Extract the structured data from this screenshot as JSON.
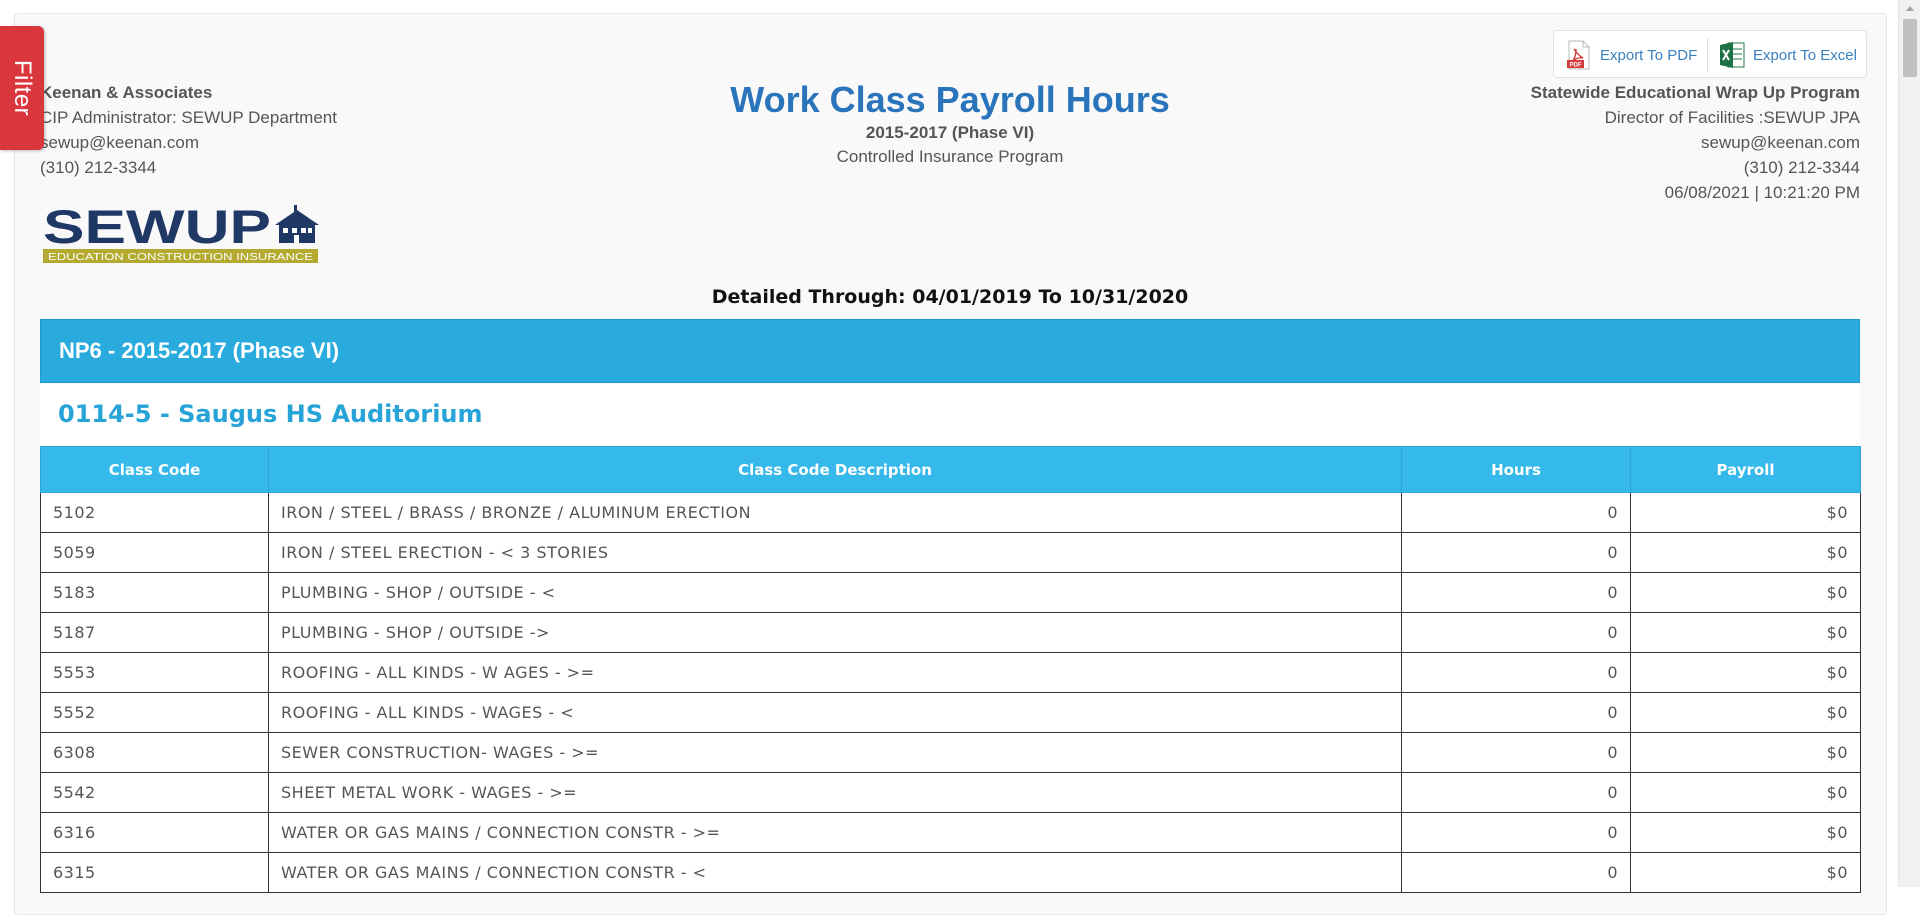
{
  "filter_tab": {
    "label": "Filter"
  },
  "export": {
    "pdf_label": "Export To PDF",
    "excel_label": "Export To Excel"
  },
  "left_info": {
    "company": "Keenan & Associates",
    "administrator": "CIP Administrator: SEWUP Department",
    "email": "sewup@keenan.com",
    "phone": "(310) 212-3344"
  },
  "logo": {
    "text": "SEWUP",
    "tagline": "EDUCATION CONSTRUCTION INSURANCE"
  },
  "header": {
    "title": "Work Class Payroll Hours",
    "subtitle": "2015-2017 (Phase VI)",
    "program": "Controlled Insurance Program"
  },
  "right_info": {
    "program_name": "Statewide Educational Wrap Up Program",
    "director": "Director of Facilities :SEWUP JPA",
    "email": "sewup@keenan.com",
    "phone": "(310) 212-3344",
    "datetime": "06/08/2021 | 10:21:20 PM"
  },
  "detailed_through": "Detailed Through: 04/01/2019 To 10/31/2020",
  "group_title": "NP6 - 2015-2017 (Phase VI)",
  "project_title": "0114-5 - Saugus HS Auditorium",
  "table": {
    "headers": [
      "Class Code",
      "Class Code Description",
      "Hours",
      "Payroll"
    ],
    "rows": [
      [
        "5102",
        "IRON / STEEL / BRASS / BRONZE / ALUMINUM ERECTION",
        "0",
        "$0"
      ],
      [
        "5059",
        "IRON / STEEL ERECTION - < 3 STORIES",
        "0",
        "$0"
      ],
      [
        "5183",
        "PLUMBING - SHOP / OUTSIDE - <",
        "0",
        "$0"
      ],
      [
        "5187",
        "PLUMBING - SHOP / OUTSIDE ->",
        "0",
        "$0"
      ],
      [
        "5553",
        "ROOFING - ALL KINDS - W AGES - >=",
        "0",
        "$0"
      ],
      [
        "5552",
        "ROOFING - ALL KINDS - WAGES - <",
        "0",
        "$0"
      ],
      [
        "6308",
        "SEWER CONSTRUCTION- WAGES - >=",
        "0",
        "$0"
      ],
      [
        "5542",
        "SHEET METAL WORK - WAGES - >=",
        "0",
        "$0"
      ],
      [
        "6316",
        "WATER OR GAS MAINS / CONNECTION CONSTR - >=",
        "0",
        "$0"
      ],
      [
        "6315",
        "WATER OR GAS MAINS / CONNECTION CONSTR - <",
        "0",
        "$0"
      ]
    ]
  }
}
